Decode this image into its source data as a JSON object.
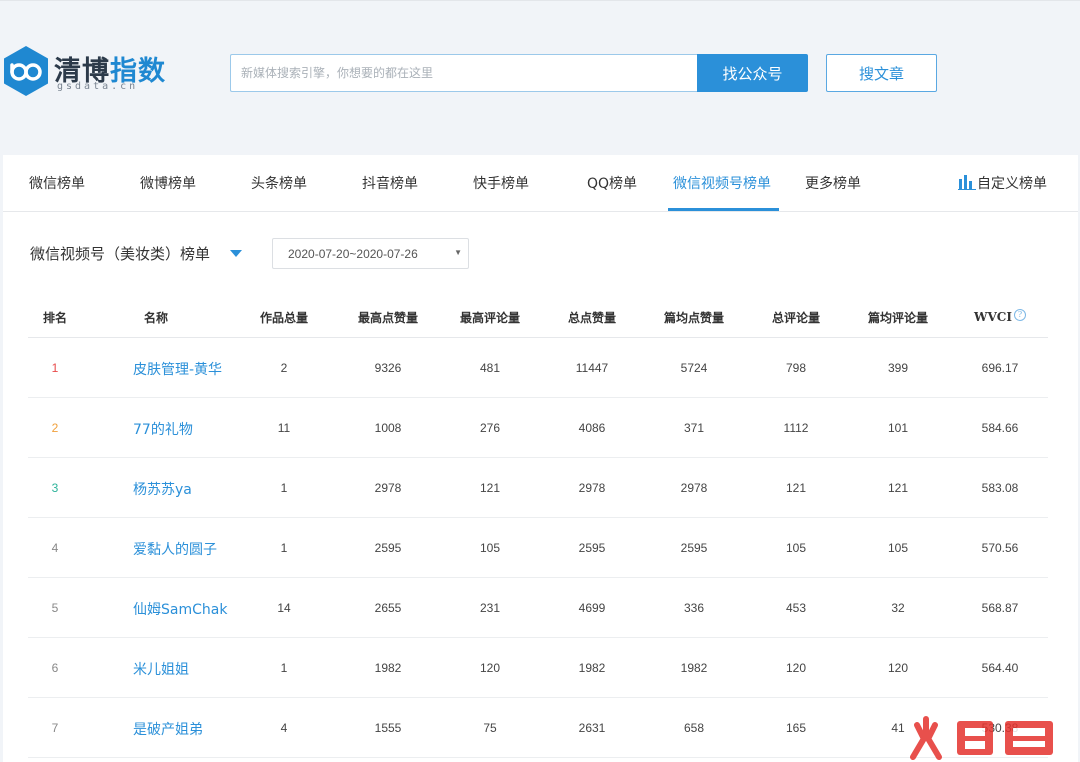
{
  "logo": {
    "title_part1": "清博",
    "title_part2": "指数",
    "subtitle": "gsdata.cn"
  },
  "search": {
    "placeholder": "新媒体搜索引擎，你想要的都在这里",
    "find_button": "找公众号",
    "article_button": "搜文章"
  },
  "tabs": [
    {
      "label": "微信榜单",
      "active": false
    },
    {
      "label": "微博榜单",
      "active": false
    },
    {
      "label": "头条榜单",
      "active": false
    },
    {
      "label": "抖音榜单",
      "active": false
    },
    {
      "label": "快手榜单",
      "active": false
    },
    {
      "label": "QQ榜单",
      "active": false
    },
    {
      "label": "微信视频号榜单",
      "active": true
    },
    {
      "label": "更多榜单",
      "active": false
    }
  ],
  "custom_rank": {
    "label": "自定义榜单",
    "icon": "bar-chart-icon"
  },
  "section": {
    "title": "微信视频号（美妆类）榜单",
    "date_range": "2020-07-20~2020-07-26"
  },
  "table": {
    "headers": [
      "排名",
      "名称",
      "作品总量",
      "最高点赞量",
      "最高评论量",
      "总点赞量",
      "篇均点赞量",
      "总评论量",
      "篇均评论量",
      "WVCI"
    ],
    "rows": [
      [
        "1",
        "皮肤管理-黄华",
        "2",
        "9326",
        "481",
        "11447",
        "5724",
        "798",
        "399",
        "696.17"
      ],
      [
        "2",
        "77的礼物",
        "11",
        "1008",
        "276",
        "4086",
        "371",
        "1112",
        "101",
        "584.66"
      ],
      [
        "3",
        "杨苏苏ya",
        "1",
        "2978",
        "121",
        "2978",
        "2978",
        "121",
        "121",
        "583.08"
      ],
      [
        "4",
        "爱黏人的圆子",
        "1",
        "2595",
        "105",
        "2595",
        "2595",
        "105",
        "105",
        "570.56"
      ],
      [
        "5",
        "仙姆SamChak",
        "14",
        "2655",
        "231",
        "4699",
        "336",
        "453",
        "32",
        "568.87"
      ],
      [
        "6",
        "米儿姐姐",
        "1",
        "1982",
        "120",
        "1982",
        "1982",
        "120",
        "120",
        "564.40"
      ],
      [
        "7",
        "是破产姐弟",
        "4",
        "1555",
        "75",
        "2631",
        "658",
        "165",
        "41",
        "530.38"
      ]
    ]
  },
  "colors": {
    "accent": "#2b90d9",
    "rank1": "#e84a4a",
    "rank2": "#f0a03c",
    "rank3": "#2db39a"
  },
  "watermark": {
    "text": "火鲤鱼"
  }
}
